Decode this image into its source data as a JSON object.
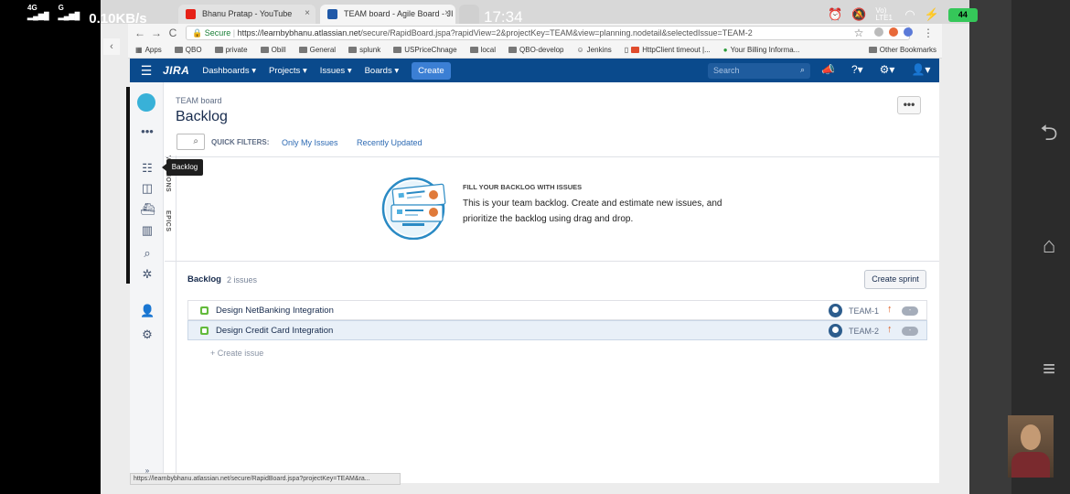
{
  "phone": {
    "net1": "4G",
    "net2": "G",
    "rate": "0.10KB/s",
    "time": "17:34",
    "volte": "Vo) LTE1",
    "battery": "44"
  },
  "browser": {
    "tabs": [
      {
        "label": "Bhanu Pratap - YouTube",
        "close": "×"
      },
      {
        "label": "TEAM board - Agile Board - JI",
        "close": "×"
      }
    ],
    "back": "←",
    "forward": "→",
    "reload": "C",
    "secure_label": "Secure",
    "url_host": "https://learnbybhanu.atlassian.net",
    "url_path": "/secure/RapidBoard.jspa?rapidView=2&projectKey=TEAM&view=planning.nodetail&selectedIssue=TEAM-2",
    "star": "☆",
    "bookmarks": [
      "Apps",
      "QBO",
      "private",
      "Obill",
      "General",
      "splunk",
      "USPriceChnage",
      "local",
      "QBO-develop",
      "Jenkins",
      "HttpClient timeout |...",
      "Your Billing Informa..."
    ],
    "other_bookmarks": "Other Bookmarks",
    "status_url": "https://learnbybhanu.atlassian.net/secure/RapidBoard.jspa?projectKey=TEAM&ra..."
  },
  "jira": {
    "logo": "JIRA",
    "nav": [
      "Dashboards ▾",
      "Projects ▾",
      "Issues ▾",
      "Boards ▾"
    ],
    "create": "Create",
    "search_placeholder": "Search",
    "tooltip": "Backlog",
    "vtabs": [
      "VERSIONS",
      "EPICS"
    ],
    "board_name": "TEAM board",
    "page_title": "Backlog",
    "more": "•••",
    "quick_filters_label": "QUICK FILTERS:",
    "quick_filters": [
      "Only My Issues",
      "Recently Updated"
    ],
    "empty_heading": "FILL YOUR BACKLOG WITH ISSUES",
    "empty_text": "This is your team backlog. Create and estimate new issues, and prioritize the backlog using drag and drop.",
    "backlog_title": "Backlog",
    "backlog_count": "2 issues",
    "create_sprint": "Create sprint",
    "issues": [
      {
        "summary": "Design NetBanking Integration",
        "key": "TEAM-1",
        "priority": "↑",
        "estimate": "-"
      },
      {
        "summary": "Design Credit Card Integration",
        "key": "TEAM-2",
        "priority": "↑",
        "estimate": "-"
      }
    ],
    "create_issue": "+ Create issue"
  },
  "colors": {
    "jira_nav": "#0a4a8c",
    "link": "#2d6ab3",
    "story": "#63ba3c",
    "selected_row": "#e9f0f8"
  }
}
